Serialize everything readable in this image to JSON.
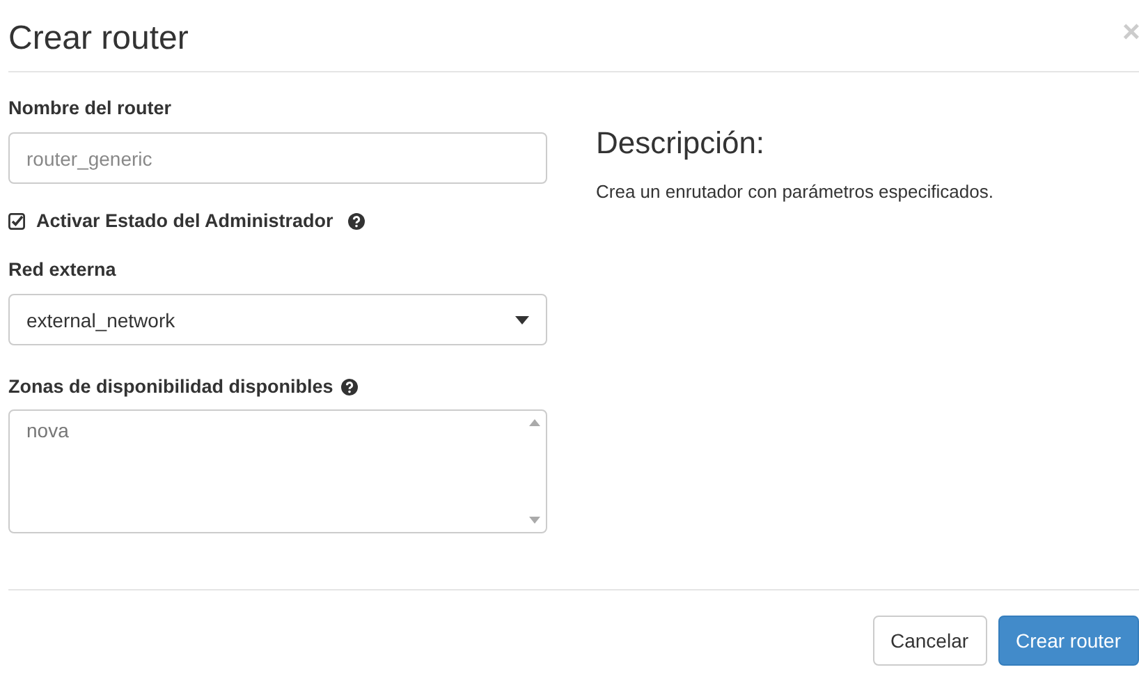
{
  "dialog": {
    "title": "Crear router",
    "close": "×"
  },
  "form": {
    "name_label": "Nombre del router",
    "name_field": {
      "placeholder": "router_generic"
    },
    "admin_state": {
      "label": "Activar Estado del Administrador",
      "checked": true
    },
    "network_label": "Red externa",
    "network_select": {
      "value": "external_network"
    },
    "zones_label": "Zonas de disponibilidad disponibles",
    "zones_list": [
      "nova"
    ]
  },
  "description": {
    "heading": "Descripción:",
    "text": "Crea un enrutador con parámetros especificados."
  },
  "buttons": [
    {
      "label": "Cancelar",
      "kind": "secondary"
    },
    {
      "label": "Crear router",
      "kind": "primary"
    }
  ]
}
